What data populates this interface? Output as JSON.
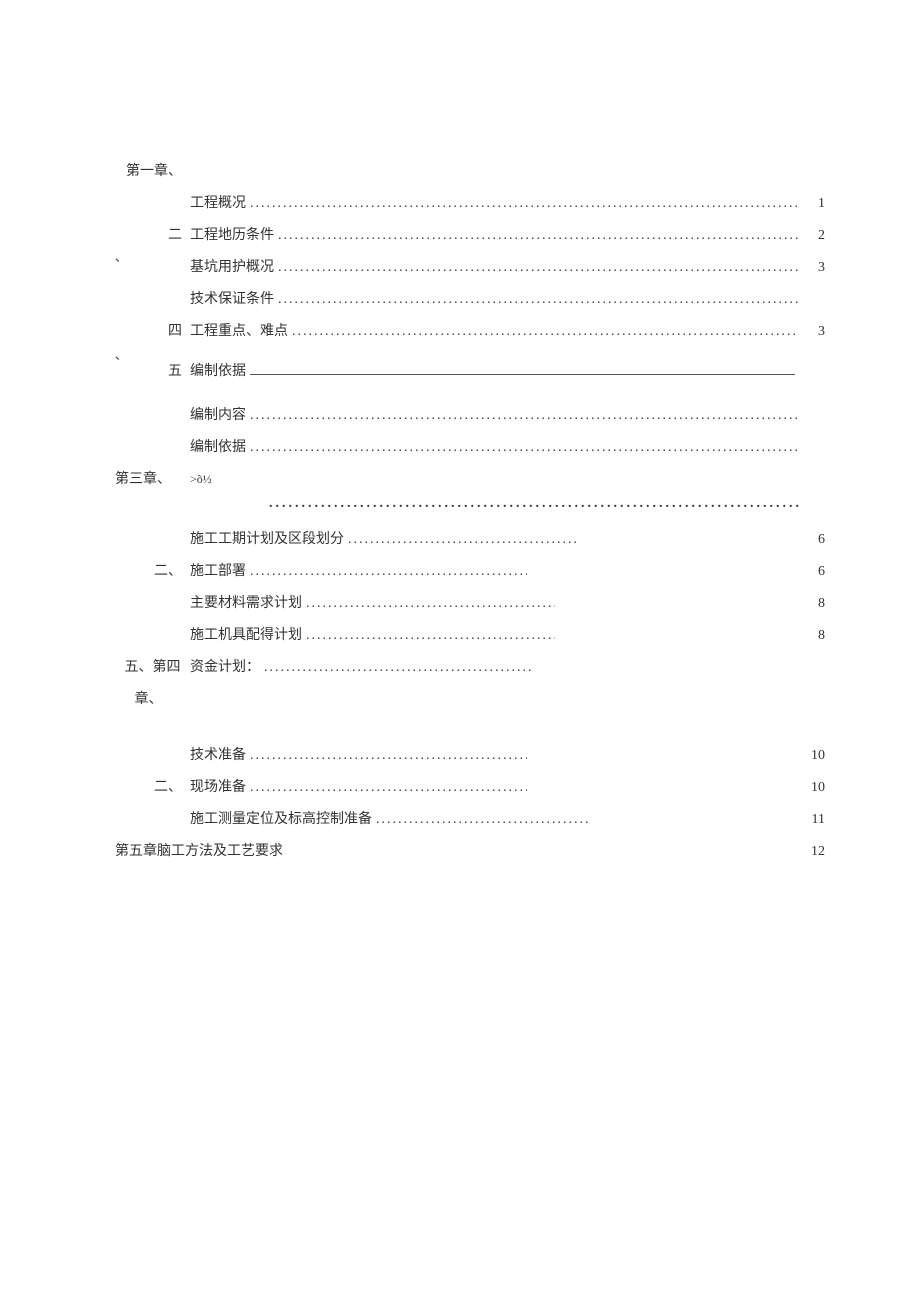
{
  "toc": {
    "chapter1": {
      "label": "第一章、",
      "items": [
        {
          "label": "",
          "text": "工程概况",
          "page": "1"
        },
        {
          "label": "二",
          "text": "工程地历条件",
          "page": "2"
        },
        {
          "label": "",
          "text": "基坑用护概况",
          "page": "3"
        },
        {
          "label": "",
          "text": "技术保证条件",
          "page": ""
        },
        {
          "label": "四",
          "text": "工程重点、难点",
          "page": "3"
        },
        {
          "label": "五",
          "text": "编制依据",
          "page": "",
          "style": "underscore"
        },
        {
          "label": "",
          "text": "编制内容",
          "page": ""
        },
        {
          "label": "",
          "text": "编制依据",
          "page": ""
        }
      ]
    },
    "chapter3": {
      "label": "第三章、",
      "suffix": ">õ½",
      "items": [
        {
          "label": "",
          "text": "施工工期计划及区段划分",
          "page": "6"
        },
        {
          "label": "二、",
          "text": "施工部署",
          "page": "6"
        },
        {
          "label": "",
          "text": "主要材料需求计划",
          "page": "8"
        },
        {
          "label": "",
          "text": "施工机具配得计划",
          "page": "8"
        },
        {
          "label": "五、第四",
          "text": "资金计划：",
          "page": ""
        },
        {
          "label_below": "章、"
        }
      ]
    },
    "chapter4_items": [
      {
        "label": "",
        "text": "技术准备",
        "page": "10"
      },
      {
        "label": "二、",
        "text": "现场准备",
        "page": "10"
      },
      {
        "label": "",
        "text": "施工测量定位及标高控制准备",
        "page": "11"
      }
    ],
    "chapter5": {
      "label": "第五章脑工方法及工艺要求",
      "page": "12"
    },
    "commas": {
      "c1": "、",
      "c2": "、"
    }
  }
}
